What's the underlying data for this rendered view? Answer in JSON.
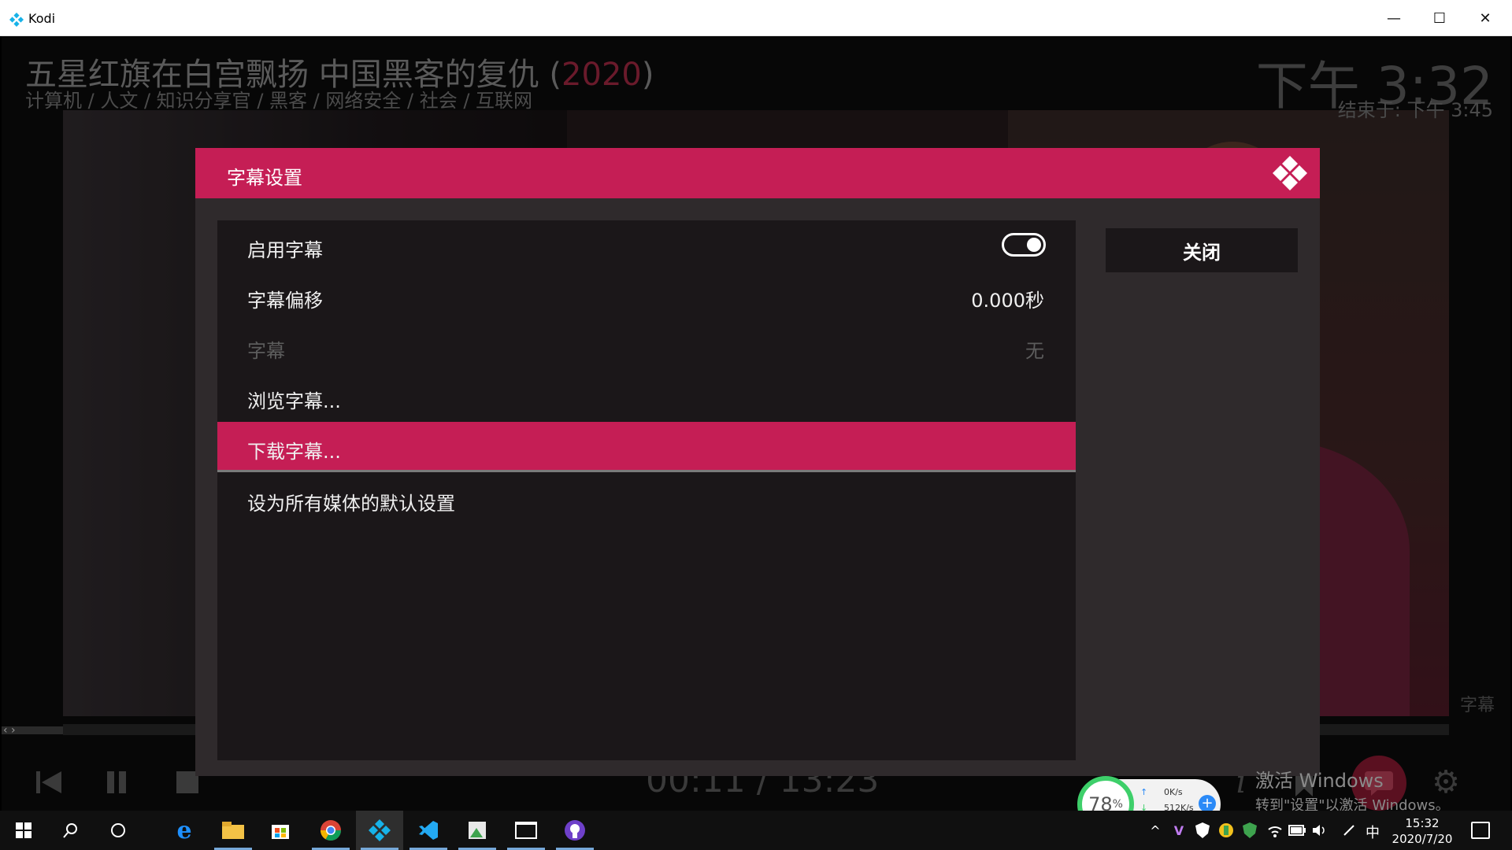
{
  "window": {
    "app_title": "Kodi",
    "min_glyph": "—",
    "max_glyph": "☐",
    "close_glyph": "✕"
  },
  "osd": {
    "title_main": "五星红旗在白宫飘扬 中国黑客的复仇 (",
    "title_year": "2020",
    "title_tail": ")",
    "genres": "计算机 / 人文 / 知识分享官 / 黑客 / 网络安全 / 社会 / 互联网",
    "clock": "下午 3:32",
    "end_time": "结束于: 下午 3:45",
    "subtitle_label": "字幕",
    "time": "00:11 / 13:23",
    "arrows": "‹ ›"
  },
  "dialog": {
    "title": "字幕设置",
    "close_button": "关闭",
    "settings": [
      {
        "label": "启用字幕",
        "value": "",
        "type": "toggle",
        "enabled": true,
        "state": "on"
      },
      {
        "label": "字幕偏移",
        "value": "0.000秒",
        "type": "value",
        "enabled": true
      },
      {
        "label": "字幕",
        "value": "无",
        "type": "value",
        "enabled": false
      },
      {
        "label": "浏览字幕...",
        "value": "",
        "type": "action",
        "enabled": true
      },
      {
        "label": "下载字幕...",
        "value": "",
        "type": "action",
        "enabled": true,
        "focused": true
      },
      {
        "label": "设为所有媒体的默认设置",
        "value": "",
        "type": "action",
        "enabled": true
      }
    ]
  },
  "watermark": {
    "line1": "激活 Windows",
    "line2": "转到\"设置\"以激活 Windows。"
  },
  "net_widget": {
    "percent": "78",
    "percent_unit": "%",
    "upload": "0K/s",
    "download": "512K/s"
  },
  "taskbar": {
    "time": "15:32",
    "date": "2020/7/20",
    "ime": "中"
  },
  "colors": {
    "accent": "#c51e55",
    "dialog_bg": "#2f2a2c",
    "list_bg": "#1b1719"
  }
}
